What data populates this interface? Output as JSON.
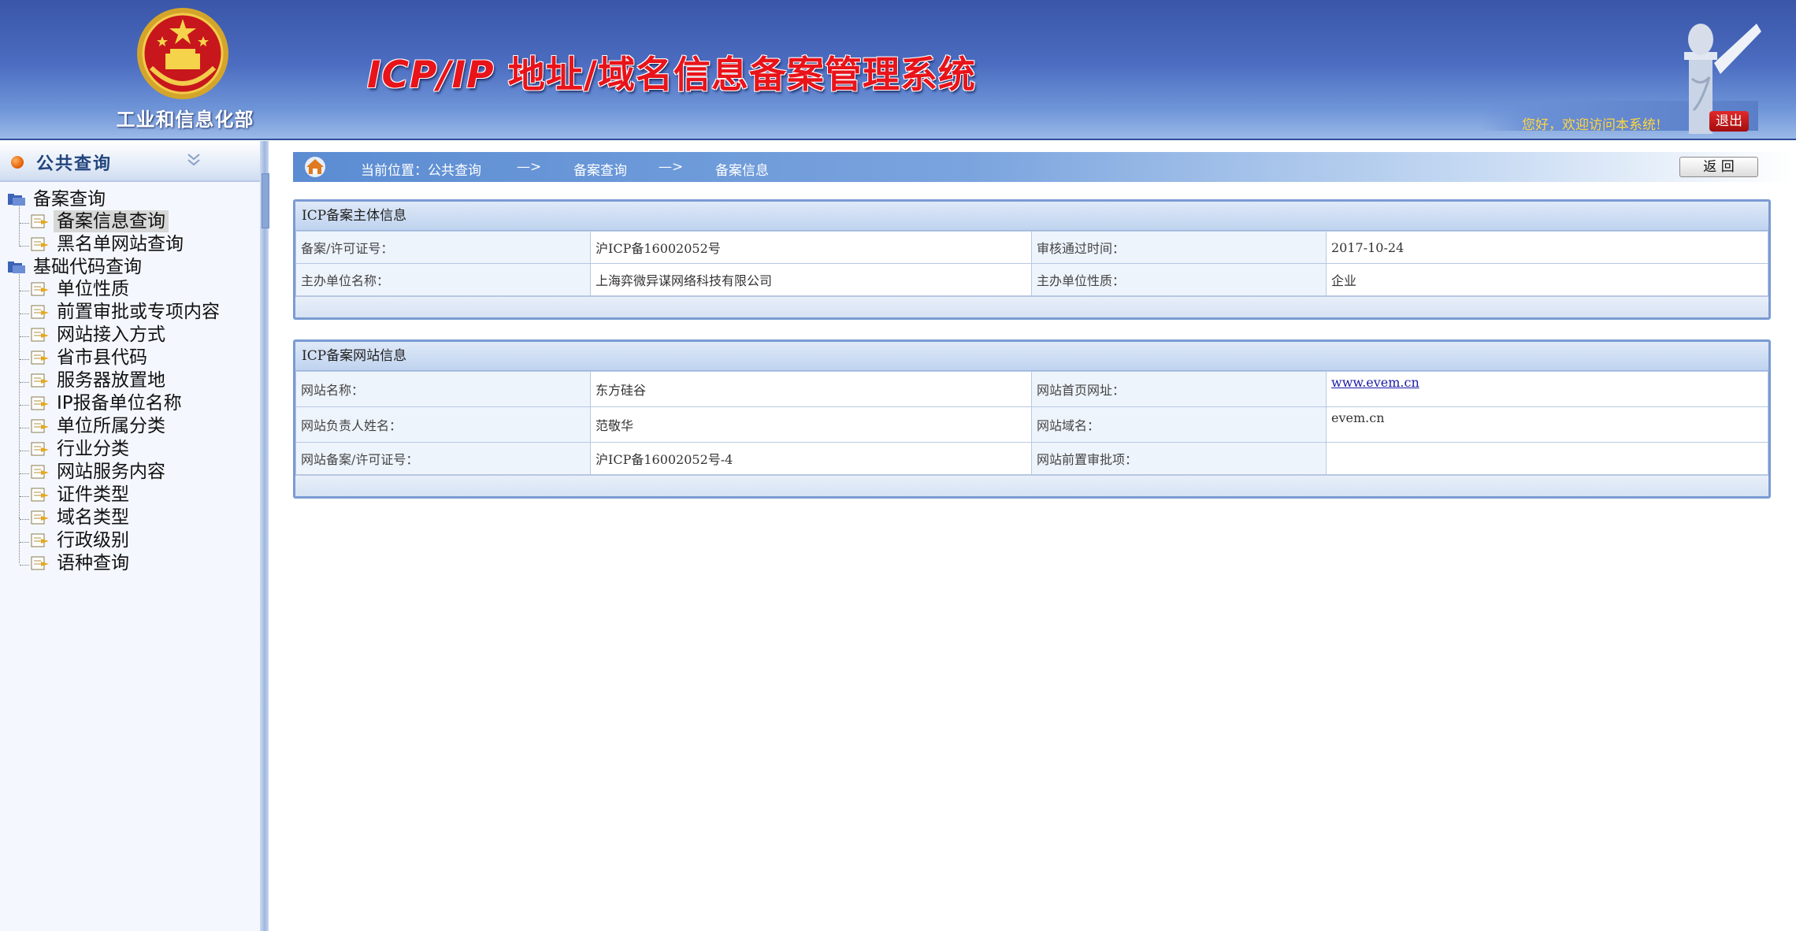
{
  "header": {
    "ministry_name": "工业和信息化部",
    "system_title_prefix": "ICP/IP",
    "system_title_rest": " 地址/域名信息备案管理系统",
    "welcome": "您好，欢迎访问本系统!",
    "logout_label": "退出"
  },
  "sidebar": {
    "title": "公共查询",
    "groups": [
      {
        "label": "备案查询",
        "items": [
          {
            "label": "备案信息查询",
            "selected": true
          },
          {
            "label": "黑名单网站查询"
          }
        ]
      },
      {
        "label": "基础代码查询",
        "items": [
          {
            "label": "单位性质"
          },
          {
            "label": "前置审批或专项内容"
          },
          {
            "label": "网站接入方式"
          },
          {
            "label": "省市县代码"
          },
          {
            "label": "服务器放置地"
          },
          {
            "label": "IP报备单位名称"
          },
          {
            "label": "单位所属分类"
          },
          {
            "label": "行业分类"
          },
          {
            "label": "网站服务内容"
          },
          {
            "label": "证件类型"
          },
          {
            "label": "域名类型"
          },
          {
            "label": "行政级别"
          },
          {
            "label": "语种查询"
          }
        ]
      }
    ]
  },
  "breadcrumb": {
    "prefix": "当前位置：公共查询",
    "sep": "—>",
    "level2": "备案查询",
    "level3": "备案信息"
  },
  "back_label": "返 回",
  "subject_panel": {
    "title": "ICP备案主体信息",
    "rows": [
      {
        "l1": "备案/许可证号：",
        "v1": "沪ICP备16002052号",
        "l2": "审核通过时间：",
        "v2": "2017-10-24"
      },
      {
        "l1": "主办单位名称：",
        "v1": "上海弈微异谋网络科技有限公司",
        "l2": "主办单位性质：",
        "v2": "企业"
      }
    ]
  },
  "site_panel": {
    "title": "ICP备案网站信息",
    "rows": [
      {
        "l1": "网站名称：",
        "v1": "东方硅谷",
        "l2": "网站首页网址：",
        "v2": "www.evem.cn"
      },
      {
        "l1": "网站负责人姓名：",
        "v1": "范敬华",
        "l2": "网站域名：",
        "v2": "evem.cn"
      },
      {
        "l1": "网站备案/许可证号：",
        "v1": "沪ICP备16002052号-4",
        "l2": "网站前置审批项：",
        "v2": ""
      }
    ]
  },
  "colors": {
    "header_blue": "#3a56a8",
    "title_red": "#e8141a",
    "welcome_yellow": "#ffd640",
    "panel_border": "#7a9bd3"
  },
  "icons": [
    "national-emblem-icon",
    "huabiao-icon",
    "collapse-chevron-icon",
    "folder-icon",
    "leaf-page-icon",
    "home-icon"
  ]
}
